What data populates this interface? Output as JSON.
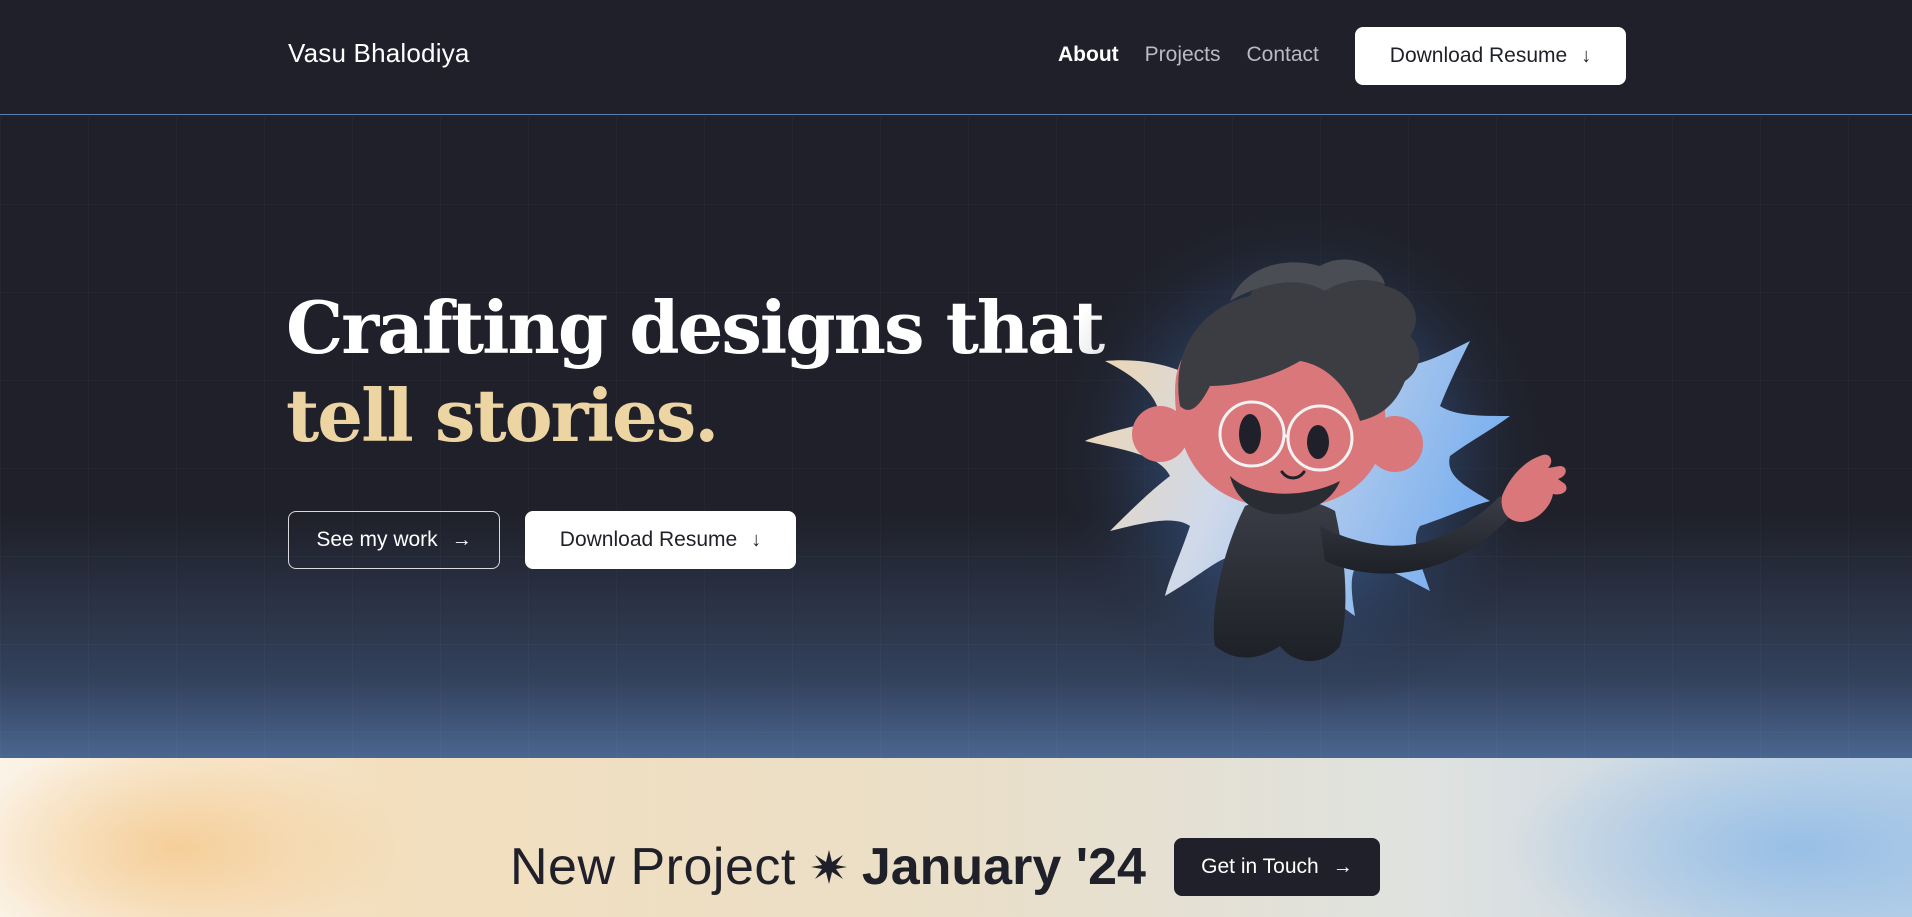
{
  "nav": {
    "brand": "Vasu Bhalodiya",
    "links": [
      {
        "label": "About",
        "active": true
      },
      {
        "label": "Projects",
        "active": false
      },
      {
        "label": "Contact",
        "active": false
      }
    ],
    "resume_button": "Download Resume",
    "resume_icon": "arrow-down-icon"
  },
  "hero": {
    "headline_line1": "Crafting designs that",
    "headline_line2": "tell stories.",
    "primary_button": "See my work",
    "primary_icon": "arrow-right-icon",
    "secondary_button": "Download Resume",
    "secondary_icon": "arrow-down-icon",
    "illustration": "waving-avatar-character"
  },
  "banner": {
    "text": "New Project",
    "separator_icon": "star-burst-icon",
    "highlight": "January '24",
    "button": "Get in Touch",
    "button_icon": "arrow-right-icon"
  },
  "colors": {
    "background": "#1f2029",
    "accent_gold": "#ecd5a2",
    "nav_border": "#5b7fae",
    "white": "#ffffff"
  }
}
